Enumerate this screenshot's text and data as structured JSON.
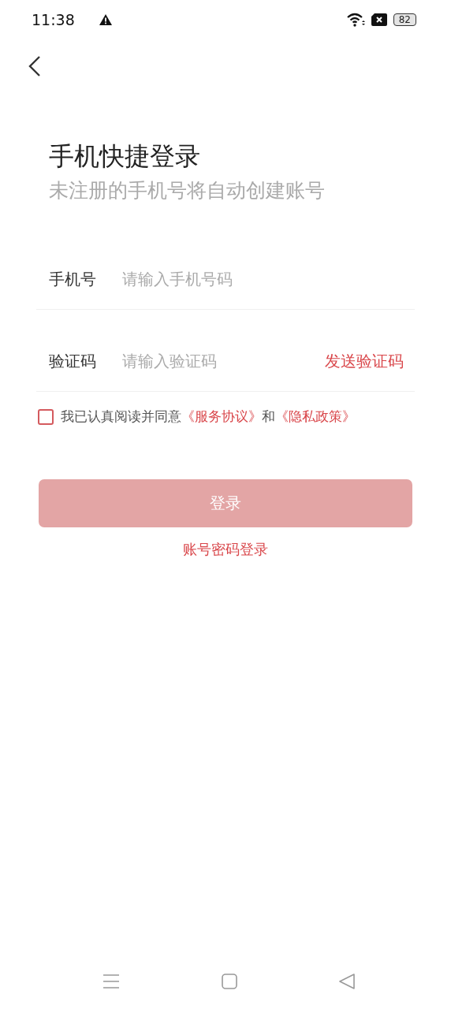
{
  "status_bar": {
    "time": "11:38",
    "battery": "82"
  },
  "header": {
    "title": "手机快捷登录",
    "subtitle": "未注册的手机号将自动创建账号"
  },
  "fields": [
    {
      "label": "手机号",
      "placeholder": "请输入手机号码"
    },
    {
      "label": "验证码",
      "placeholder": "请输入验证码",
      "action": "发送验证码"
    }
  ],
  "agreement": {
    "checked": false,
    "parts": [
      {
        "kind": "text",
        "text": "我已认真阅读并同意"
      },
      {
        "kind": "link",
        "text": "《服务协议》"
      },
      {
        "kind": "text",
        "text": "和"
      },
      {
        "kind": "link",
        "text": "《隐私政策》"
      }
    ]
  },
  "login_button": {
    "label": "登录",
    "disabled": true
  },
  "alt_link": "账号密码登录"
}
